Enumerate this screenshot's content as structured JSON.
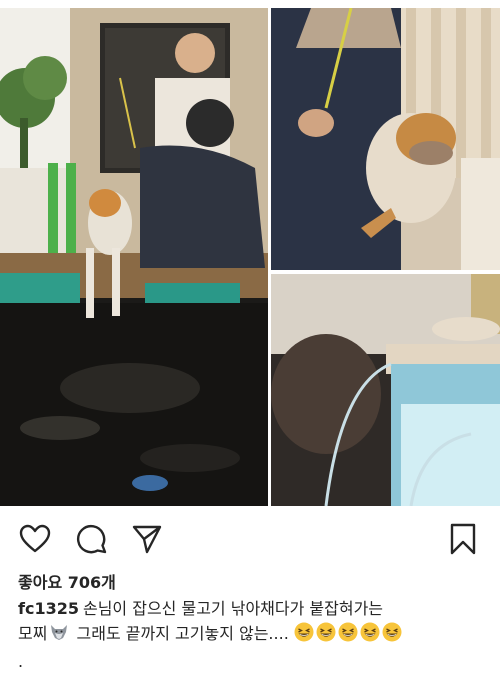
{
  "post": {
    "likes_label": "좋아요 706개",
    "username": "fc1325",
    "caption_line1": "손님이 잡으신 물고기 낚아채다가 붙잡혀가는",
    "caption_line2_start": "모찌",
    "caption_line2_end": " 그래도 끝까지 고기놓지 않는....",
    "caption_emojis": [
      "grinning-squint-face",
      "grinning-squint-face",
      "grinning-squint-face",
      "grinning-squint-face",
      "grinning-squint-face"
    ],
    "caption_line3": "."
  },
  "actions": {
    "icons": [
      "heart-icon",
      "comment-icon",
      "share-icon",
      "bookmark-icon"
    ]
  },
  "colors": {
    "text": "#262626",
    "background": "#ffffff"
  }
}
